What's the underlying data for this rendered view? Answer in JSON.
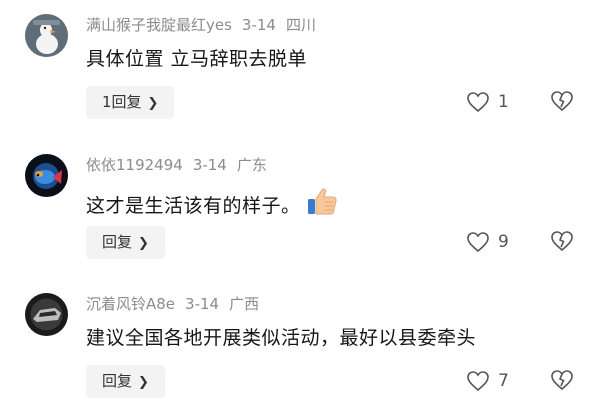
{
  "comments": [
    {
      "username": "满山猴子我腚最红yes",
      "date": "3-14",
      "location": "四川",
      "text": "具体位置 立马辞职去脱单",
      "reply_label": "1回复",
      "like_count": "1",
      "avatar_icon": "goose-avatar-icon"
    },
    {
      "username": "依依1192494",
      "date": "3-14",
      "location": "广东",
      "text": "这才是生活该有的样子。",
      "reply_label": "回复",
      "like_count": "9",
      "emoji_icon": "thumbs-up-emoji-icon",
      "avatar_icon": "fish-avatar-icon"
    },
    {
      "username": "沉着风铃A8e",
      "date": "3-14",
      "location": "广西",
      "text": "建议全国各地开展类似活动，最好以县委牵头",
      "reply_label": "回复",
      "like_count": "7",
      "avatar_icon": "car-logo-avatar-icon"
    }
  ],
  "colors": {
    "meta": "#8c8c8c",
    "text": "#161616",
    "button_bg": "#f3f3f3"
  }
}
